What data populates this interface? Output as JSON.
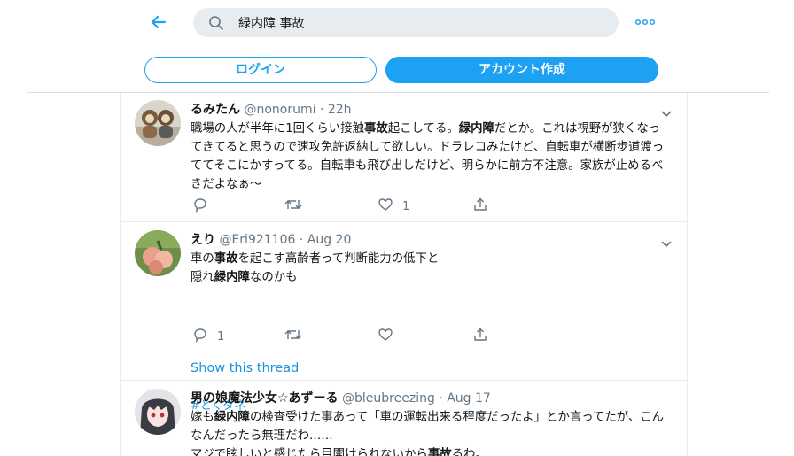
{
  "topbar": {
    "search_query": "緑内障 事故"
  },
  "auth": {
    "login_label": "ログイン",
    "signup_label": "アカウント作成"
  },
  "tweets": [
    {
      "name": "るみたん",
      "handle": "@nonorumi",
      "time": "22h",
      "lines": [
        [
          "職場の人が半年に1回くらい接触",
          "事故",
          "起こしてる。",
          "緑内障",
          "だとか。これは視野が狭くなっ"
        ],
        [
          "てきてると思うので速攻免許返納して欲しい。ドラレコみたけど、自転車が横断歩道渡っ"
        ],
        [
          "ててそこにかすってる。自転車も飛び出しだけど、明らかに前方不注意。家族が止めるべ"
        ],
        [
          "きだよなぁ～"
        ]
      ],
      "replies": "",
      "retweets": "",
      "likes": "1"
    },
    {
      "name": "えり",
      "handle": "@Eri921106",
      "time": "Aug 20",
      "line1_a": "車の",
      "line1_b": "事故",
      "line1_c": "を起こす高齢者って判断能力の低下と",
      "line2_a": "隠れ",
      "line2_b": "緑内障",
      "line2_c": "なのかも",
      "hashtag": "#とくダネ",
      "replies": "1",
      "retweets": "",
      "likes": "",
      "show_thread": "Show this thread"
    },
    {
      "name": "男の娘魔法少女☆あずーる",
      "handle": "@bleubreezing",
      "time": "Aug 17",
      "line1_a": "嫁も",
      "line1_b": "緑内障",
      "line1_c": "の検査受けた事あって「車の運転出来る程度だったよ」とか言ってたが、こん",
      "line2": "なんだったら無理だわ……",
      "line3_a": "マジで眩しいと感じたら目開けられないから",
      "line3_b": "事故",
      "line3_c": "るわ。"
    }
  ]
}
